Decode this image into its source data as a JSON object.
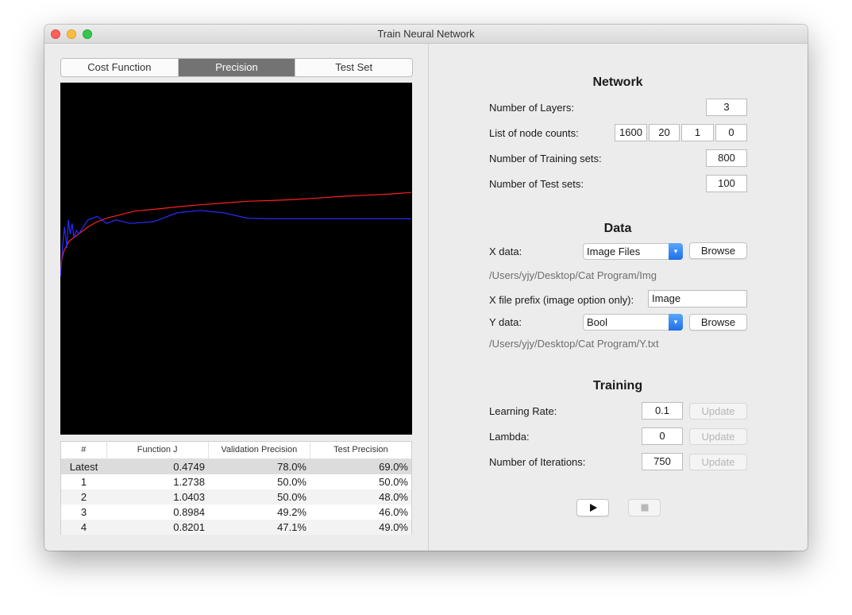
{
  "window": {
    "title": "Train Neural Network"
  },
  "tabs": [
    "Cost Function",
    "Precision",
    "Test Set"
  ],
  "active_tab": "Precision",
  "chart_data": {
    "type": "line",
    "title": "",
    "xlabel": "",
    "ylabel": "",
    "background": "#000000",
    "grid": false,
    "legend": "none",
    "xlim": [
      1,
      750
    ],
    "ylim": [
      0,
      100
    ],
    "series": [
      {
        "color": "#ff2020",
        "x": [
          1,
          3,
          8,
          20,
          40,
          60,
          80,
          100,
          130,
          160,
          200,
          250,
          300,
          350,
          400,
          450,
          500,
          550,
          600,
          650,
          700,
          750
        ],
        "values": [
          45,
          49,
          52,
          55,
          57,
          59,
          60.5,
          61.5,
          62.5,
          63.5,
          64,
          64.7,
          65.3,
          65.8,
          66.3,
          66.5,
          66.8,
          67.2,
          67.7,
          68,
          68.3,
          68.8
        ]
      },
      {
        "color": "#2a2aff",
        "x": [
          1,
          3,
          6,
          10,
          15,
          18,
          22,
          26,
          30,
          35,
          40,
          50,
          60,
          80,
          100,
          120,
          150,
          200,
          250,
          300,
          350,
          400,
          450,
          500,
          550,
          600,
          650,
          700,
          750
        ],
        "values": [
          45,
          48,
          54,
          59,
          53,
          61,
          57,
          60,
          56,
          58,
          57,
          59,
          61,
          62,
          60,
          61,
          60,
          60.5,
          63,
          63.7,
          63,
          61.5,
          61.3,
          61.3,
          61.3,
          61.3,
          61.3,
          61.3,
          61.3
        ]
      }
    ]
  },
  "table": {
    "headers": [
      "#",
      "Function J",
      "Validation Precision",
      "Test Precision"
    ],
    "rows": [
      [
        "Latest",
        "0.4749",
        "78.0%",
        "69.0%"
      ],
      [
        "1",
        "1.2738",
        "50.0%",
        "50.0%"
      ],
      [
        "2",
        "1.0403",
        "50.0%",
        "48.0%"
      ],
      [
        "3",
        "0.8984",
        "49.2%",
        "46.0%"
      ],
      [
        "4",
        "0.8201",
        "47.1%",
        "49.0%"
      ]
    ]
  },
  "network": {
    "heading": "Network",
    "layers_label": "Number of Layers:",
    "layers": "3",
    "node_counts_label": "List of node counts:",
    "node_counts": [
      "1600",
      "20",
      "1",
      "0"
    ],
    "training_sets_label": "Number of Training sets:",
    "training_sets": "800",
    "test_sets_label": "Number of Test sets:",
    "test_sets": "100"
  },
  "data": {
    "heading": "Data",
    "x_label": "X data:",
    "x_select": "Image Files",
    "x_path": "/Users/yjy/Desktop/Cat Program/Img",
    "prefix_label": "X file prefix (image option only):",
    "prefix": "Image",
    "y_label": "Y data:",
    "y_select": "Bool",
    "y_path": "/Users/yjy/Desktop/Cat Program/Y.txt",
    "browse_label": "Browse"
  },
  "training": {
    "heading": "Training",
    "lr_label": "Learning Rate:",
    "lr": "0.1",
    "lambda_label": "Lambda:",
    "lambda": "0",
    "iter_label": "Number of Iterations:",
    "iterations": "750",
    "update_label": "Update",
    "play_icon": "play-icon",
    "stop_icon": "stop-icon"
  }
}
